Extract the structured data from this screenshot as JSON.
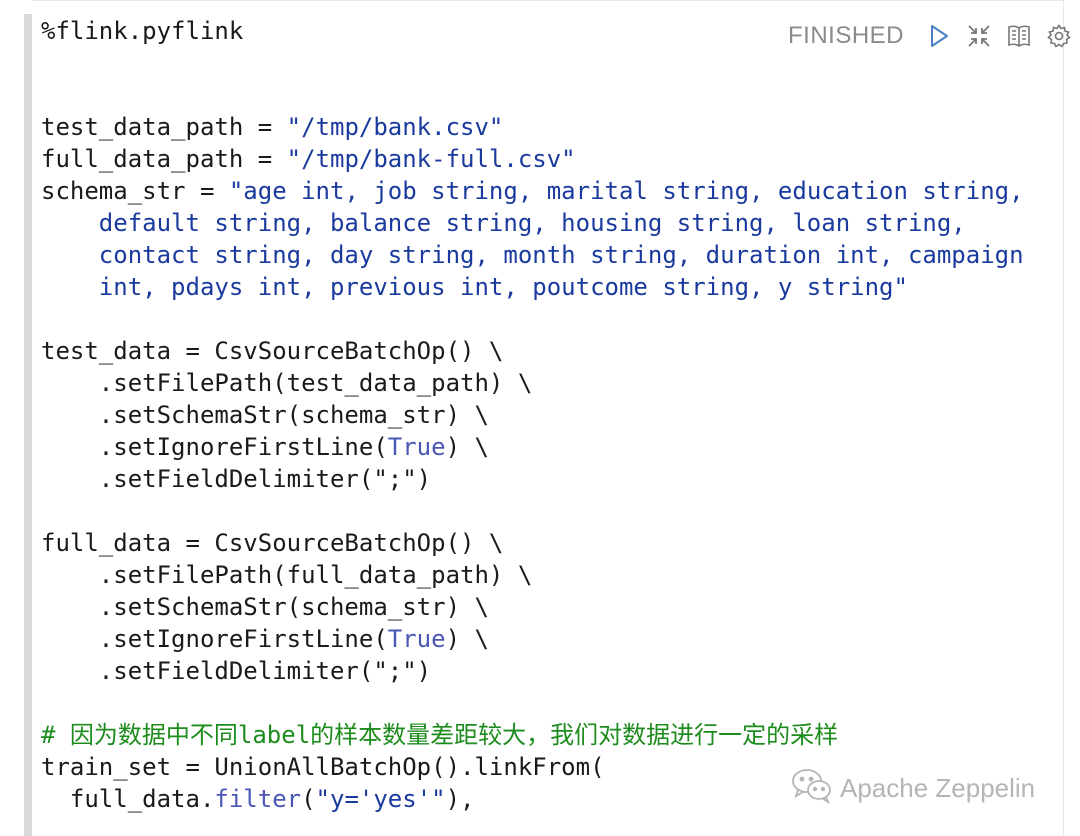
{
  "paragraph": {
    "status": "FINISHED",
    "toolbar_icons": [
      "play-icon",
      "collapse-icon",
      "book-icon",
      "gear-icon"
    ]
  },
  "code_lines": [
    [
      {
        "t": "%flink.pyflink",
        "c": ""
      }
    ],
    [
      {
        "t": "",
        "c": ""
      }
    ],
    [
      {
        "t": "",
        "c": ""
      }
    ],
    [
      {
        "t": "test_data_path = ",
        "c": ""
      },
      {
        "t": "\"/tmp/bank.csv\"",
        "c": "str"
      }
    ],
    [
      {
        "t": "full_data_path = ",
        "c": ""
      },
      {
        "t": "\"/tmp/bank-full.csv\"",
        "c": "str"
      }
    ],
    [
      {
        "t": "schema_str = ",
        "c": ""
      },
      {
        "t": "\"age int, job string, marital string, education string,",
        "c": "str"
      }
    ],
    [
      {
        "t": "    default string, balance string, housing string, loan string,",
        "c": "str"
      }
    ],
    [
      {
        "t": "    contact string, day string, month string, duration int, campaign",
        "c": "str"
      }
    ],
    [
      {
        "t": "    int, pdays int, previous int, poutcome string, y string\"",
        "c": "str"
      }
    ],
    [
      {
        "t": "",
        "c": ""
      }
    ],
    [
      {
        "t": "test_data = CsvSourceBatchOp() \\",
        "c": ""
      }
    ],
    [
      {
        "t": "    .setFilePath(test_data_path) \\",
        "c": ""
      }
    ],
    [
      {
        "t": "    .setSchemaStr(schema_str) \\",
        "c": ""
      }
    ],
    [
      {
        "t": "    .setIgnoreFirstLine(",
        "c": ""
      },
      {
        "t": "True",
        "c": "kw"
      },
      {
        "t": ") \\",
        "c": ""
      }
    ],
    [
      {
        "t": "    .setFieldDelimiter(\";\")",
        "c": ""
      }
    ],
    [
      {
        "t": "",
        "c": ""
      }
    ],
    [
      {
        "t": "full_data = CsvSourceBatchOp() \\",
        "c": ""
      }
    ],
    [
      {
        "t": "    .setFilePath(full_data_path) \\",
        "c": ""
      }
    ],
    [
      {
        "t": "    .setSchemaStr(schema_str) \\",
        "c": ""
      }
    ],
    [
      {
        "t": "    .setIgnoreFirstLine(",
        "c": ""
      },
      {
        "t": "True",
        "c": "kw"
      },
      {
        "t": ") \\",
        "c": ""
      }
    ],
    [
      {
        "t": "    .setFieldDelimiter(\";\")",
        "c": ""
      }
    ],
    [
      {
        "t": "",
        "c": ""
      }
    ],
    [
      {
        "t": "# 因为数据中不同label的样本数量差距较大，我们对数据进行一定的采样",
        "c": "cmt"
      }
    ],
    [
      {
        "t": "train_set = UnionAllBatchOp().linkFrom(",
        "c": ""
      }
    ],
    [
      {
        "t": "  full_data.",
        "c": ""
      },
      {
        "t": "filter",
        "c": "kw"
      },
      {
        "t": "(",
        "c": ""
      },
      {
        "t": "\"y='yes'\"",
        "c": "str"
      },
      {
        "t": "),",
        "c": ""
      }
    ]
  ],
  "watermark": {
    "text": "Apache Zeppelin",
    "icon": "wechat-icon"
  }
}
